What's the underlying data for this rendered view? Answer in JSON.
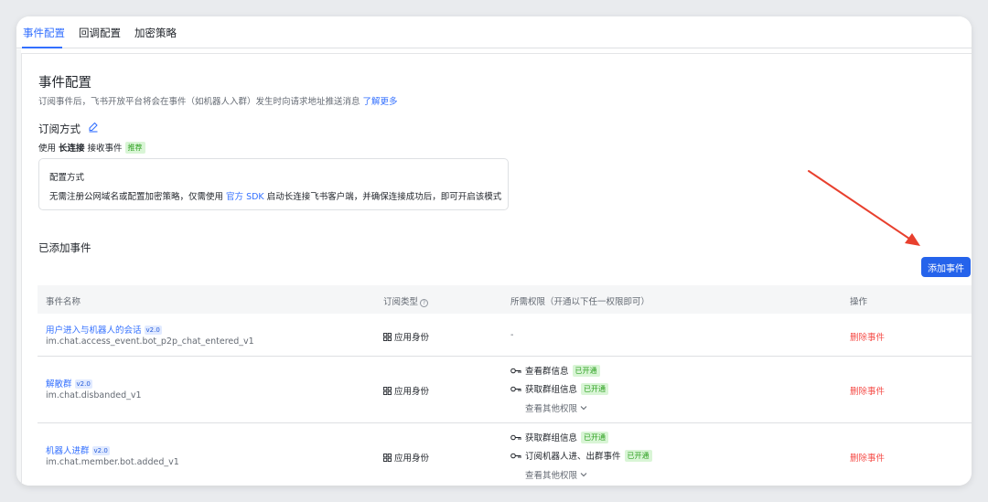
{
  "tabs": [
    {
      "label": "事件配置",
      "active": true
    },
    {
      "label": "回调配置",
      "active": false
    },
    {
      "label": "加密策略",
      "active": false
    }
  ],
  "section": {
    "title": "事件配置",
    "description": "订阅事件后，飞书开放平台将会在事件（如机器人入群）发生时向请求地址推送消息",
    "learn_more": "了解更多"
  },
  "subscription": {
    "title": "订阅方式",
    "mode_prefix": "使用",
    "mode_strong": "长连接",
    "mode_suffix": "接收事件",
    "recommended_tag": "推荐"
  },
  "config_box": {
    "title": "配置方式",
    "desc_prefix": "无需注册公网域名或配置加密策略，仅需使用",
    "desc_link": "官方 SDK",
    "desc_suffix": "启动长连接飞书客户端，并确保连接成功后，即可开启该模式"
  },
  "events": {
    "title": "已添加事件",
    "add_button": "添加事件",
    "columns": {
      "name": "事件名称",
      "type": "订阅类型",
      "permissions": "所需权限（开通以下任一权限即可）",
      "actions": "操作"
    },
    "rows": [
      {
        "name": "用户进入与机器人的会话",
        "version": "v2.0",
        "key": "im.chat.access_event.bot_p2p_chat_entered_v1",
        "type": "应用身份",
        "permissions_empty": "-",
        "delete": "删除事件"
      },
      {
        "name": "解散群",
        "version": "v2.0",
        "key": "im.chat.disbanded_v1",
        "type": "应用身份",
        "permissions": [
          {
            "label": "查看群信息",
            "status": "已开通"
          },
          {
            "label": "获取群组信息",
            "status": "已开通"
          }
        ],
        "more": "查看其他权限",
        "delete": "删除事件"
      },
      {
        "name": "机器人进群",
        "version": "v2.0",
        "key": "im.chat.member.bot.added_v1",
        "type": "应用身份",
        "permissions": [
          {
            "label": "获取群组信息",
            "status": "已开通"
          },
          {
            "label": "订阅机器人进、出群事件",
            "status": "已开通"
          }
        ],
        "more": "查看其他权限",
        "delete": "删除事件"
      }
    ]
  },
  "colors": {
    "accent": "#3370ff",
    "button": "#2563eb",
    "danger": "#f54a45",
    "success": "#2ea121",
    "annotation_arrow": "#e8402e"
  }
}
